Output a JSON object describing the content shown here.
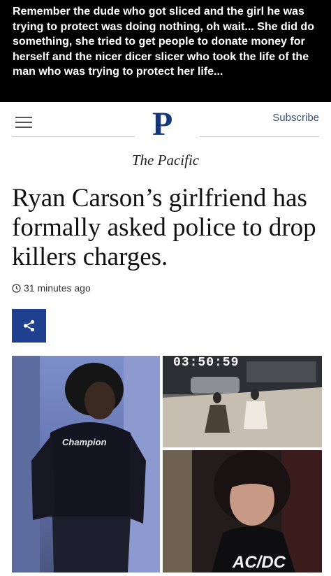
{
  "caption": {
    "text": "Remember the dude who got sliced and the girl he was trying to protect was doing nothing, oh wait... She did do something, she tried to get people to donate money for herself and the nicer dicer slicer who took the life of the man who was trying to protect her life..."
  },
  "header": {
    "logo_letter": "P",
    "subscribe_label": "Subscribe",
    "publication_name": "The Pacific"
  },
  "article": {
    "headline": "Ryan Carson’s girlfriend has formally asked police to drop killers charges.",
    "timestamp": "31 minutes ago"
  },
  "photo": {
    "cctv_timestamp": "03:50:59",
    "shirt_logo": "Champion",
    "shirt_band": "AC/DC"
  }
}
